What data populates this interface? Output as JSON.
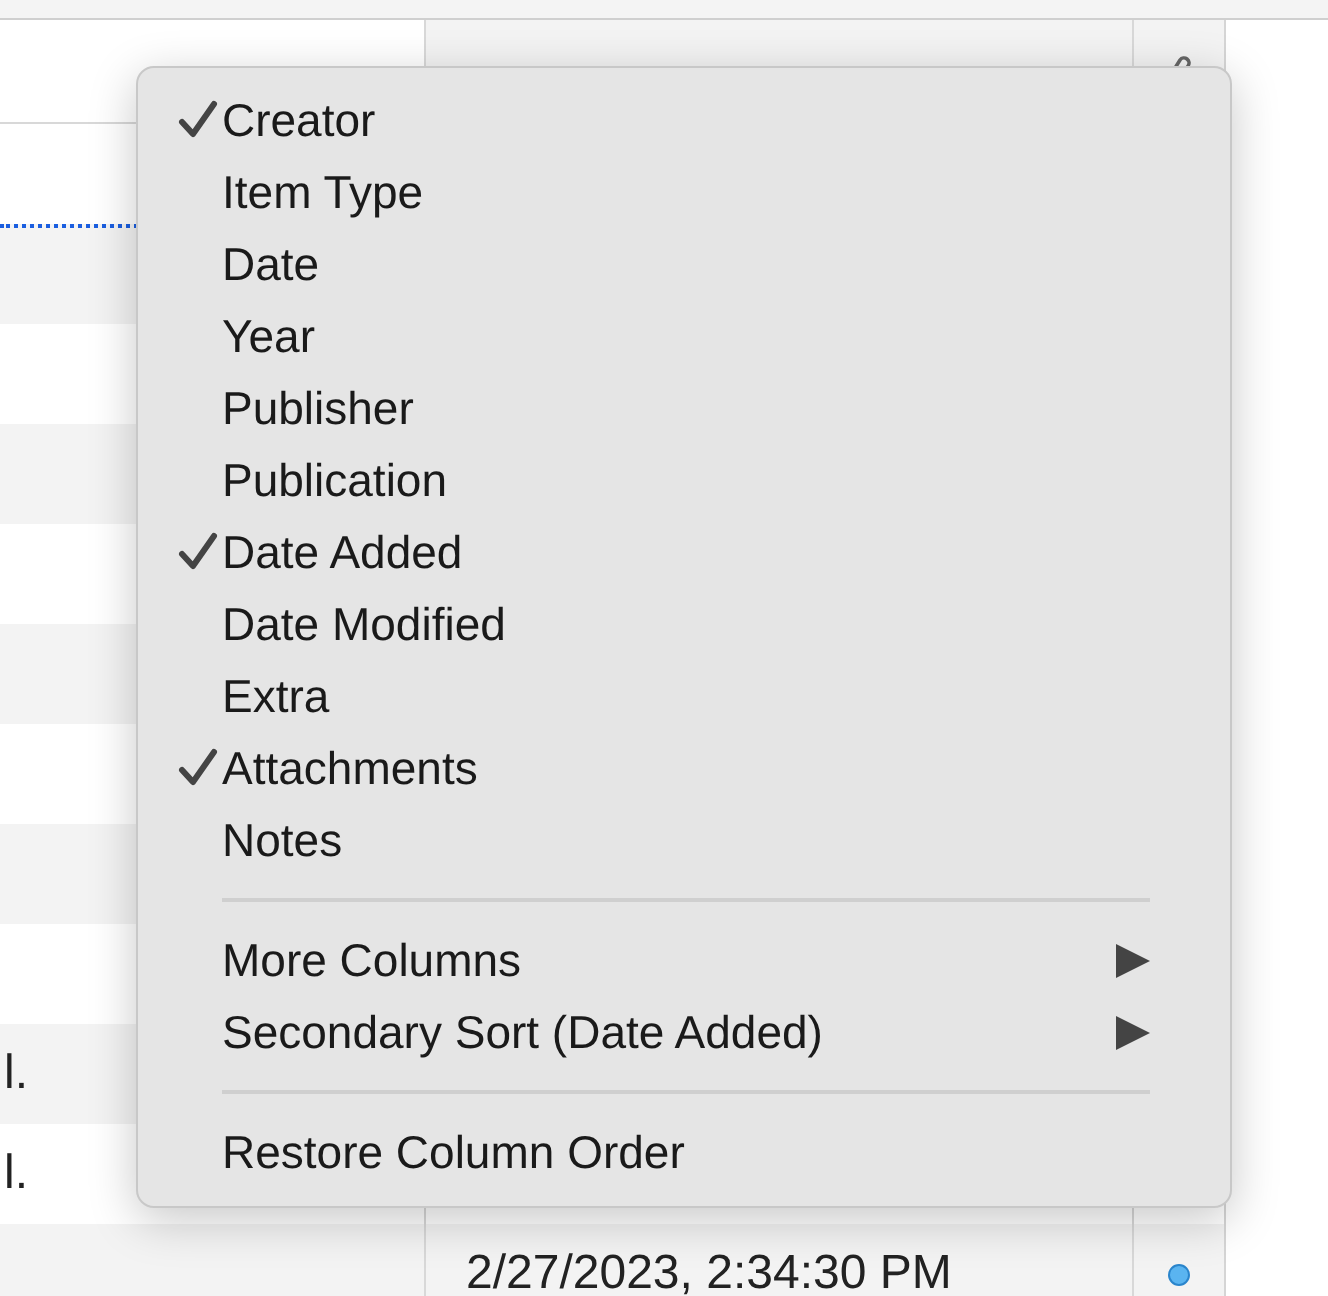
{
  "table": {
    "columns": [
      {
        "kind": "title"
      },
      {
        "kind": "date"
      },
      {
        "kind": "attachments"
      }
    ],
    "rows": [
      {
        "title": "l."
      },
      {
        "title": "l."
      },
      {
        "date_added": "2/27/2023, 2:34:30 PM",
        "attachment": true
      }
    ]
  },
  "menu": {
    "items": [
      {
        "kind": "option",
        "label": "Creator",
        "checked": true
      },
      {
        "kind": "option",
        "label": "Item Type",
        "checked": false
      },
      {
        "kind": "option",
        "label": "Date",
        "checked": false
      },
      {
        "kind": "option",
        "label": "Year",
        "checked": false
      },
      {
        "kind": "option",
        "label": "Publisher",
        "checked": false
      },
      {
        "kind": "option",
        "label": "Publication",
        "checked": false
      },
      {
        "kind": "option",
        "label": "Date Added",
        "checked": true
      },
      {
        "kind": "option",
        "label": "Date Modified",
        "checked": false
      },
      {
        "kind": "option",
        "label": "Extra",
        "checked": false
      },
      {
        "kind": "option",
        "label": "Attachments",
        "checked": true
      },
      {
        "kind": "option",
        "label": "Notes",
        "checked": false
      },
      {
        "kind": "separator"
      },
      {
        "kind": "submenu",
        "label": "More Columns"
      },
      {
        "kind": "submenu",
        "label": "Secondary Sort (Date Added)"
      },
      {
        "kind": "separator"
      },
      {
        "kind": "action",
        "label": "Restore Column Order"
      }
    ]
  }
}
